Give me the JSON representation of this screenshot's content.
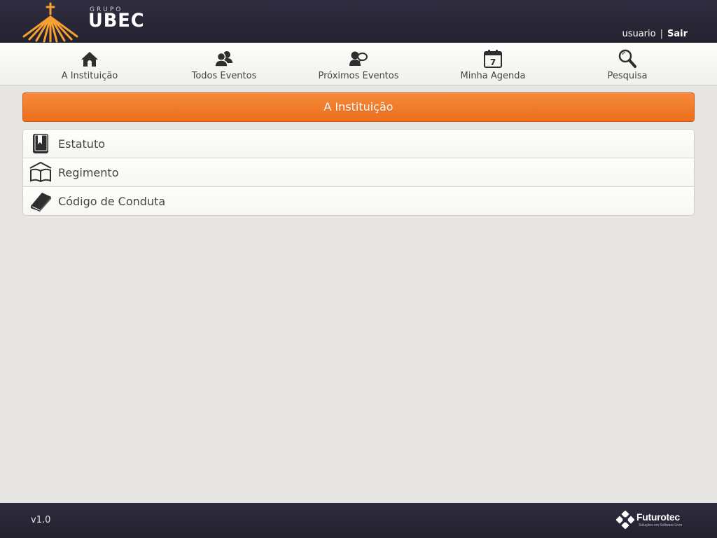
{
  "header": {
    "logo": {
      "prefix": "GRUPO",
      "name": "UBEC"
    },
    "user": {
      "username": "usuario",
      "separator": "|",
      "logout_label": "Sair"
    }
  },
  "nav": {
    "items": [
      {
        "label": "A Instituição",
        "icon": "house-icon"
      },
      {
        "label": "Todos Eventos",
        "icon": "users-icon"
      },
      {
        "label": "Próximos Eventos",
        "icon": "user-chat-icon"
      },
      {
        "label": "Minha Agenda",
        "icon": "calendar-icon",
        "icon_text": "7"
      },
      {
        "label": "Pesquisa",
        "icon": "magnifier-icon"
      }
    ]
  },
  "page": {
    "title": "A Instituição",
    "items": [
      {
        "label": "Estatuto",
        "icon": "book-bookmark-icon"
      },
      {
        "label": "Regimento",
        "icon": "open-book-icon"
      },
      {
        "label": "Código de Conduta",
        "icon": "closed-book-icon"
      }
    ]
  },
  "footer": {
    "version": "v1.0",
    "brand": {
      "name": "Futurotec",
      "tagline": "Soluções em Software Livre"
    }
  },
  "colors": {
    "header_bg": "#2b2939",
    "accent_orange": "#f07a28",
    "logo_orange": "#f5a030",
    "nav_bg": "#f8f7f4",
    "page_bg": "#e6e5e3",
    "icon_dark": "#2e2e2e"
  }
}
